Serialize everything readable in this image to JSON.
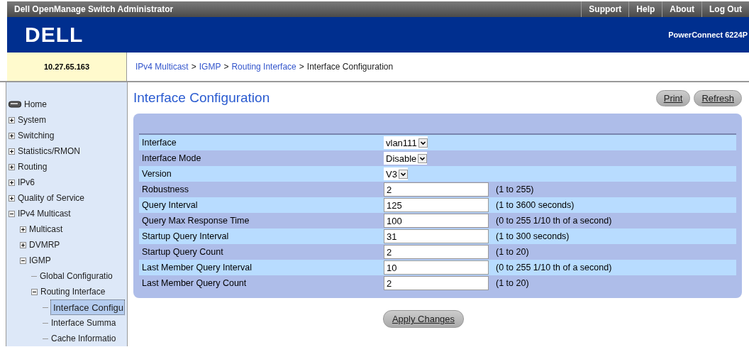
{
  "app_title": "Dell OpenManage Switch Administrator",
  "top_links": [
    "Support",
    "Help",
    "About",
    "Log Out"
  ],
  "logo": "DELL",
  "model": "PowerConnect 6224P",
  "ip_address": "10.27.65.163",
  "breadcrumb": {
    "separator": ">",
    "links": [
      "IPv4 Multicast",
      "IGMP",
      "Routing Interface"
    ],
    "current": "Interface Configuration"
  },
  "sidebar": {
    "items": [
      {
        "label": "Home",
        "kind": "home"
      },
      {
        "label": "System",
        "kind": "folder",
        "expanded": false
      },
      {
        "label": "Switching",
        "kind": "folder",
        "expanded": false
      },
      {
        "label": "Statistics/RMON",
        "kind": "folder",
        "expanded": false
      },
      {
        "label": "Routing",
        "kind": "folder",
        "expanded": false
      },
      {
        "label": "IPv6",
        "kind": "folder",
        "expanded": false
      },
      {
        "label": "Quality of Service",
        "kind": "folder",
        "expanded": false
      },
      {
        "label": "IPv4 Multicast",
        "kind": "folder",
        "expanded": true,
        "children": [
          {
            "label": "Multicast",
            "kind": "folder",
            "expanded": false
          },
          {
            "label": "DVMRP",
            "kind": "folder",
            "expanded": false
          },
          {
            "label": "IGMP",
            "kind": "folder",
            "expanded": true,
            "children": [
              {
                "label": "Global Configuratio",
                "kind": "page",
                "selected": false
              },
              {
                "label": "Routing Interface",
                "kind": "folder",
                "expanded": true,
                "children": [
                  {
                    "label": "Interface Configu",
                    "kind": "page",
                    "selected": true
                  },
                  {
                    "label": "Interface Summa",
                    "kind": "page",
                    "selected": false
                  },
                  {
                    "label": "Cache Informatio",
                    "kind": "page",
                    "selected": false
                  }
                ]
              }
            ]
          }
        ]
      }
    ]
  },
  "page_title": "Interface Configuration",
  "actions": [
    "Print",
    "Refresh"
  ],
  "form": {
    "rows": [
      {
        "label": "Interface",
        "kind": "select",
        "value": "vlan111"
      },
      {
        "label": "Interface Mode",
        "kind": "select",
        "value": "Disable"
      },
      {
        "label": "Version",
        "kind": "select",
        "value": "V3"
      },
      {
        "label": "Robustness",
        "kind": "input",
        "value": "2",
        "hint": "(1 to 255)"
      },
      {
        "label": "Query Interval",
        "kind": "input",
        "value": "125",
        "hint": "(1 to 3600 seconds)"
      },
      {
        "label": "Query Max Response Time",
        "kind": "input",
        "value": "100",
        "hint": "(0 to 255 1/10 th of a second)"
      },
      {
        "label": "Startup Query Interval",
        "kind": "input",
        "value": "31",
        "hint": "(1 to 300 seconds)"
      },
      {
        "label": "Startup Query Count",
        "kind": "input",
        "value": "2",
        "hint": "(1 to 20)"
      },
      {
        "label": "Last Member Query Interval",
        "kind": "input",
        "value": "10",
        "hint": "(0 to 255 1/10 th of a second)"
      },
      {
        "label": "Last Member Query Count",
        "kind": "input",
        "value": "2",
        "hint": "(1 to 20)"
      }
    ]
  },
  "apply_button": "Apply Changes"
}
